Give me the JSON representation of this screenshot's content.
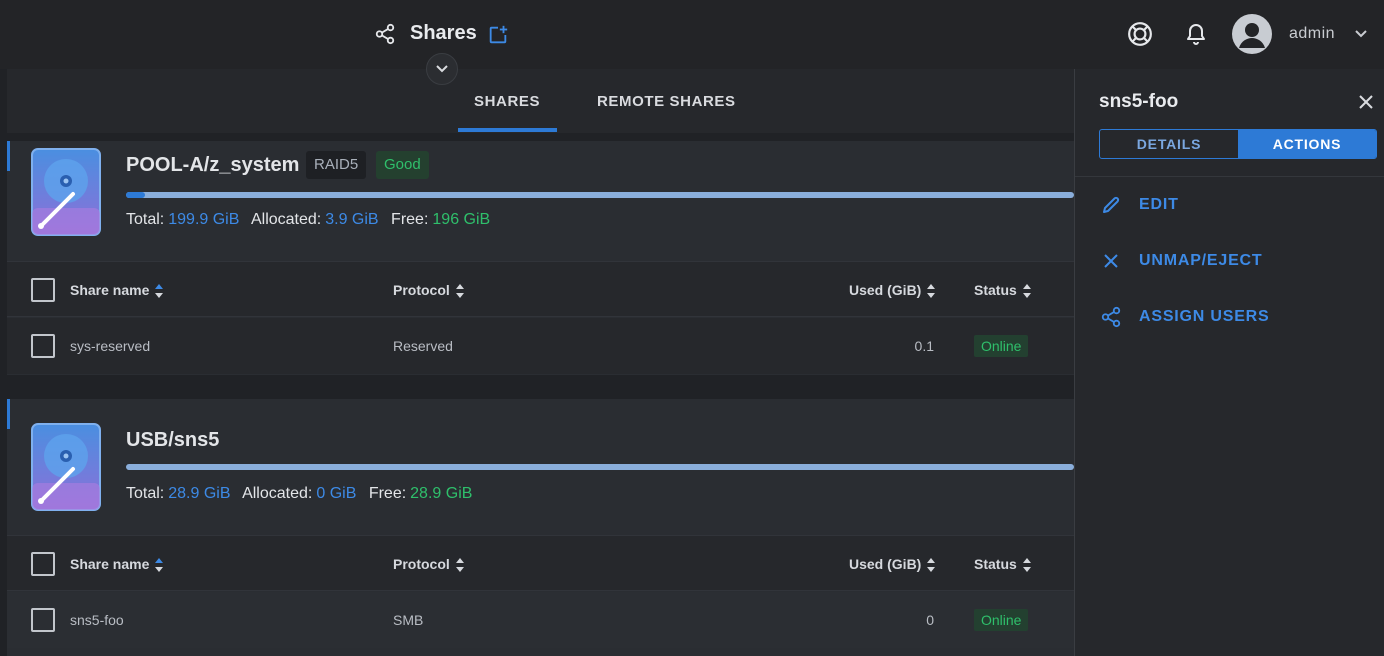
{
  "header": {
    "title": "Shares",
    "user": "admin",
    "icons": [
      "share-icon",
      "add-share-icon",
      "chevron-down-icon",
      "help-icon",
      "bell-icon",
      "avatar-icon",
      "user-menu-chevron-icon"
    ]
  },
  "tabs": [
    {
      "label": "SHARES",
      "active": true
    },
    {
      "label": "REMOTE SHARES",
      "active": false
    }
  ],
  "pools": [
    {
      "name": "POOL-A/z_system",
      "raid": "RAID5",
      "health": "Good",
      "usage_fraction": 0.02,
      "total_label": "Total:",
      "total": "199.9 GiB",
      "allocated_label": "Allocated:",
      "allocated": "3.9 GiB",
      "free_label": "Free:",
      "free": "196 GiB",
      "columns": [
        "Share name",
        "Protocol",
        "Used (GiB)",
        "Status"
      ],
      "rows": [
        {
          "name": "sys-reserved",
          "protocol": "Reserved",
          "used": "0.1",
          "status": "Online"
        }
      ]
    },
    {
      "name": "USB/sns5",
      "raid": "",
      "health": "",
      "usage_fraction": 0.0,
      "total_label": "Total:",
      "total": "28.9 GiB",
      "allocated_label": "Allocated:",
      "allocated": "0 GiB",
      "free_label": "Free:",
      "free": "28.9 GiB",
      "columns": [
        "Share name",
        "Protocol",
        "Used (GiB)",
        "Status"
      ],
      "rows": [
        {
          "name": "sns5-foo",
          "protocol": "SMB",
          "used": "0",
          "status": "Online"
        }
      ]
    }
  ],
  "panel": {
    "title": "sns5-foo",
    "segments": [
      {
        "label": "DETAILS",
        "active": false
      },
      {
        "label": "ACTIONS",
        "active": true
      }
    ],
    "actions": [
      {
        "label": "EDIT",
        "icon": "pencil-icon"
      },
      {
        "label": "UNMAP/EJECT",
        "icon": "close-icon"
      },
      {
        "label": "ASSIGN USERS",
        "icon": "share-icon"
      }
    ]
  },
  "colors": {
    "accent": "#2d7ad6",
    "good": "#2fbf6b",
    "background": "#202226",
    "card": "#2a2d32"
  }
}
